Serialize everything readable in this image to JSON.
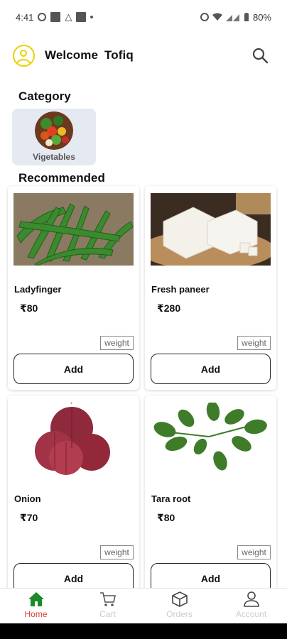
{
  "status_bar": {
    "time": "4:41",
    "battery": "80%"
  },
  "header": {
    "welcome": "Welcome",
    "user_name": "Tofiq"
  },
  "category_section": {
    "title": "Category",
    "items": [
      {
        "label": "Vigetables"
      }
    ]
  },
  "recommended_section": {
    "title": "Recommended"
  },
  "products": [
    {
      "name": "Ladyfinger",
      "price": "₹80",
      "weight_label": "weight",
      "add_label": "Add"
    },
    {
      "name": "Fresh paneer",
      "price": "₹280",
      "weight_label": "weight",
      "add_label": "Add"
    },
    {
      "name": "Onion",
      "price": "₹70",
      "weight_label": "weight",
      "add_label": "Add"
    },
    {
      "name": "Tara root",
      "price": "₹80",
      "weight_label": "weight",
      "add_label": "Add"
    }
  ],
  "bottom_nav": [
    {
      "label": "Home",
      "icon": "home-icon",
      "active": true
    },
    {
      "label": "Cart",
      "icon": "cart-icon",
      "active": false
    },
    {
      "label": "Orders",
      "icon": "box-icon",
      "active": false
    },
    {
      "label": "Account",
      "icon": "person-icon",
      "active": false
    }
  ],
  "colors": {
    "accent": "#e6d400",
    "nav_active": "#d6423a",
    "home_icon": "#1b8a2a",
    "category_bg": "#e4e9f2"
  }
}
